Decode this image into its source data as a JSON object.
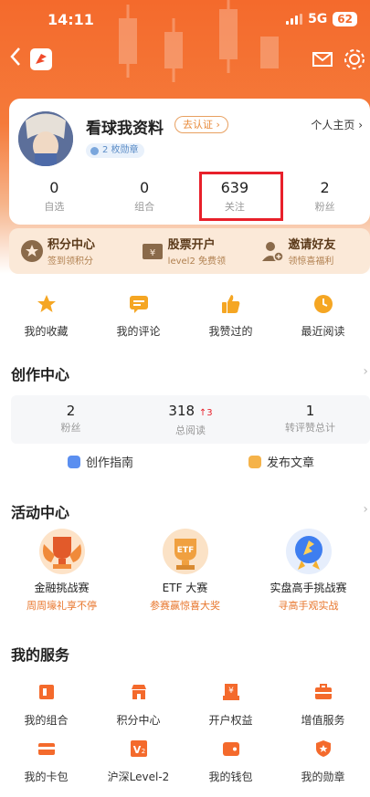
{
  "status_bar": {
    "time": "14:11",
    "network": "5G",
    "battery": "62"
  },
  "profile": {
    "username": "看球我资料",
    "verify_label": "去认证 ›",
    "badge_label": "2 枚勋章",
    "homepage_label": "个人主页 ›",
    "stats": [
      {
        "value": "0",
        "label": "自选"
      },
      {
        "value": "0",
        "label": "组合"
      },
      {
        "value": "639",
        "label": "关注"
      },
      {
        "value": "2",
        "label": "粉丝"
      }
    ]
  },
  "quick_links": [
    {
      "title": "积分中心",
      "sub": "签到领积分"
    },
    {
      "title": "股票开户",
      "sub": "level2 免费领"
    },
    {
      "title": "邀请好友",
      "sub": "领惊喜福利"
    }
  ],
  "shortcuts": [
    {
      "label": "我的收藏"
    },
    {
      "label": "我的评论"
    },
    {
      "label": "我赞过的"
    },
    {
      "label": "最近阅读"
    }
  ],
  "creation": {
    "title": "创作中心",
    "stats": [
      {
        "value": "2",
        "delta": "",
        "label": "粉丝"
      },
      {
        "value": "318",
        "delta": "↑3",
        "label": "总阅读"
      },
      {
        "value": "1",
        "delta": "",
        "label": "转评赞总计"
      }
    ],
    "guide_label": "创作指南",
    "publish_label": "发布文章"
  },
  "activities": {
    "title": "活动中心",
    "items": [
      {
        "title": "金融挑战赛",
        "sub": "周周壕礼享不停"
      },
      {
        "title": "ETF 大赛",
        "sub": "参赛赢惊喜大奖",
        "icon_text": "ETF"
      },
      {
        "title": "实盘高手挑战赛",
        "sub": "寻高手观实战"
      }
    ]
  },
  "services": {
    "title": "我的服务",
    "items": [
      {
        "label": "我的组合"
      },
      {
        "label": "积分中心"
      },
      {
        "label": "开户权益"
      },
      {
        "label": "增值服务"
      },
      {
        "label": "我的卡包"
      },
      {
        "label": "沪深Level-2"
      },
      {
        "label": "我的钱包"
      },
      {
        "label": "我的勋章"
      }
    ]
  },
  "colors": {
    "brand": "#f46a2c",
    "accent": "#e8762c",
    "highlight": "#e8202a"
  }
}
